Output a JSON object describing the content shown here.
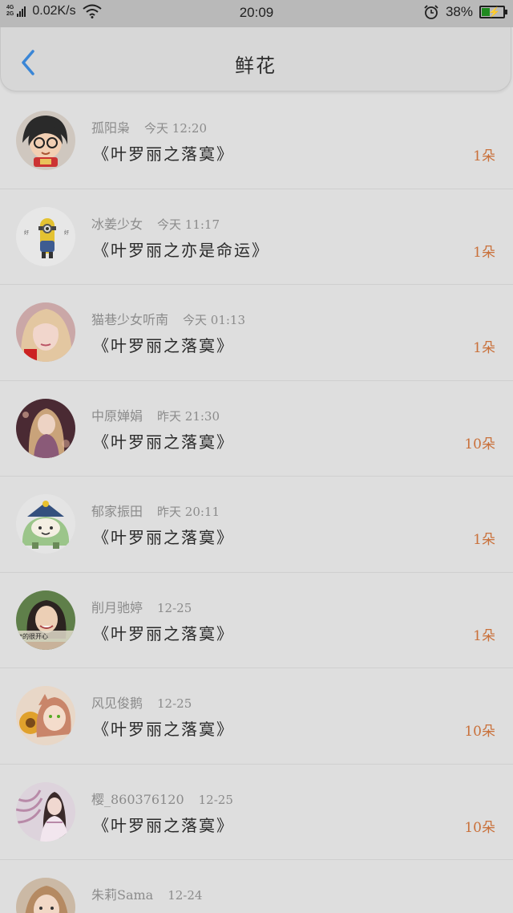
{
  "status_bar": {
    "network_type_top": "4G",
    "network_type_bottom": "2G",
    "speed": "0.02K/s",
    "time": "20:09",
    "battery": "38%",
    "battery_level": 0.38,
    "icons": [
      "signal-icon",
      "wifi-icon",
      "alarm-icon",
      "battery-icon"
    ]
  },
  "header": {
    "title": "鲜花",
    "back_icon": "chevron-left-icon",
    "accent_color": "#3a86d6"
  },
  "gifts": [
    {
      "name": "孤阳枭",
      "time": "今天 12:20",
      "title": "《叶罗丽之落寞》",
      "count": "1朵"
    },
    {
      "name": "冰姜少女",
      "time": "今天 11:17",
      "title": "《叶罗丽之亦是命运》",
      "count": "1朵"
    },
    {
      "name": "猫巷少女听南",
      "time": "今天 01:13",
      "title": "《叶罗丽之落寞》",
      "count": "1朵"
    },
    {
      "name": "中原婵娟",
      "time": "昨天 21:30",
      "title": "《叶罗丽之落寞》",
      "count": "10朵"
    },
    {
      "name": "郁家振田",
      "time": "昨天 20:11",
      "title": "《叶罗丽之落寞》",
      "count": "1朵"
    },
    {
      "name": "削月驰婷",
      "time": "12-25",
      "title": "《叶罗丽之落寞》",
      "count": "1朵"
    },
    {
      "name": "风见俊鹅",
      "time": "12-25",
      "title": "《叶罗丽之落寞》",
      "count": "10朵"
    },
    {
      "name": "樱_860376120",
      "time": "12-25",
      "title": "《叶罗丽之落寞》",
      "count": "10朵"
    },
    {
      "name": "朱莉Sama",
      "time": "12-24",
      "title": "",
      "count": ""
    }
  ],
  "colors": {
    "count_color": "#c9703a",
    "background": "#dedede"
  }
}
